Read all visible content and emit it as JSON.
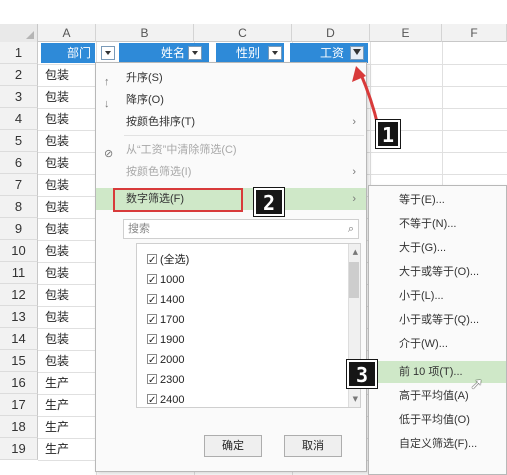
{
  "columns": [
    "A",
    "B",
    "C",
    "D",
    "E",
    "F"
  ],
  "rows": [
    "1",
    "2",
    "3",
    "4",
    "5",
    "6",
    "7",
    "8",
    "9",
    "10",
    "11",
    "12",
    "13",
    "14",
    "15",
    "16",
    "17",
    "18",
    "19"
  ],
  "header_cells": {
    "a1": "部门",
    "b1": "姓名",
    "c1": "性别",
    "d1": "工资"
  },
  "col_a_values": [
    "包装",
    "包装",
    "包装",
    "包装",
    "包装",
    "包装",
    "包装",
    "包装",
    "包装",
    "包装",
    "包装",
    "包装",
    "包装",
    "包装",
    "生产",
    "生产",
    "生产",
    "生产"
  ],
  "menu": {
    "sort_asc": "升序(S)",
    "sort_desc": "降序(O)",
    "sort_by_color": "按颜色排序(T)",
    "clear_filter": "从“工资”中清除筛选(C)",
    "filter_by_color": "按颜色筛选(I)",
    "number_filters": "数字筛选(F)",
    "search_placeholder": "搜索",
    "list_items": [
      "(全选)",
      "1000",
      "1400",
      "1700",
      "1900",
      "2000",
      "2300",
      "2400"
    ],
    "ok": "确定",
    "cancel": "取消"
  },
  "submenu": {
    "items": [
      "等于(E)...",
      "不等于(N)...",
      "大于(G)...",
      "大于或等于(O)...",
      "小于(L)...",
      "小于或等于(Q)...",
      "介于(W)...",
      "前 10 项(T)...",
      "高于平均值(A)",
      "低于平均值(O)",
      "自定义筛选(F)..."
    ]
  },
  "badges": [
    "1",
    "2",
    "3"
  ],
  "colors": {
    "header_blue": "#2e8ad8",
    "highlight_green": "#cfe8c8",
    "annotation_red": "#d83a3a"
  }
}
